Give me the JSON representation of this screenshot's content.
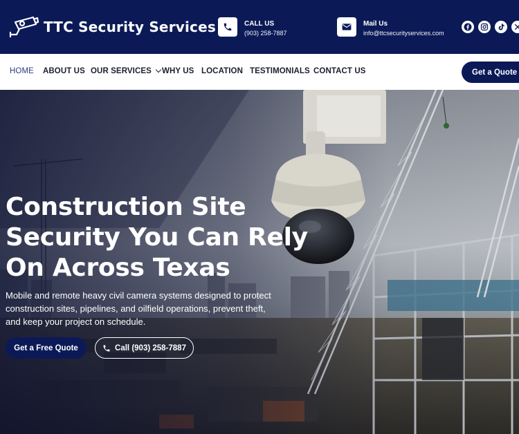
{
  "header": {
    "brand": "TTC Security Services",
    "logo_icon": "security-camera-icon",
    "call": {
      "icon": "phone-icon",
      "title": "CALL US",
      "value": "(903) 258-7887"
    },
    "mail": {
      "icon": "mail-icon",
      "title": "Mail Us",
      "value": "info@ttcsecurityservices.com"
    },
    "socials": [
      "facebook-icon",
      "instagram-icon",
      "tiktok-icon",
      "x-icon"
    ]
  },
  "nav": {
    "items": [
      {
        "label": "HOME",
        "active": true
      },
      {
        "label": "ABOUT US"
      },
      {
        "label": "OUR SERVICES",
        "dropdown": true
      },
      {
        "label": "WHY US"
      },
      {
        "label": "LOCATION"
      },
      {
        "label": "TESTIMONIALS"
      },
      {
        "label": "CONTACT US"
      }
    ],
    "cta": "Get a Quote"
  },
  "hero": {
    "headline": [
      "Construction Site",
      "Security You Can Rely",
      "On Across Texas"
    ],
    "subtext": "Mobile and remote heavy civil camera systems designed to protect construction sites, pipelines, and oilfield operations, prevent theft, and keep your project on schedule.",
    "primary_button": "Get a Free Quote",
    "secondary_button": "Call (903) 258-7887"
  },
  "colors": {
    "navy": "#0b1a57",
    "white": "#ffffff",
    "nav_text": "#1b1f2e",
    "nav_active": "#2b3a85"
  }
}
